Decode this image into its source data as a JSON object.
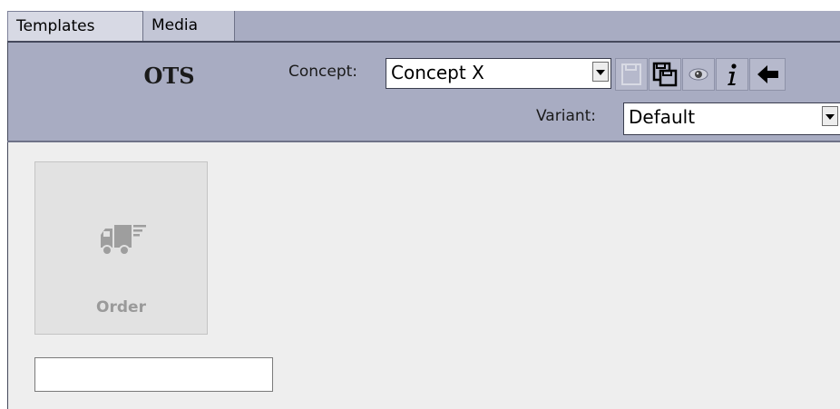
{
  "tabs": [
    {
      "label": "Templates",
      "active": true
    },
    {
      "label": "Media",
      "active": false
    }
  ],
  "header": {
    "title": "OTS",
    "concept_label": "Concept:",
    "concept_value": "Concept X",
    "variant_label": "Variant:",
    "variant_value": "Default"
  },
  "toolbar": {
    "icons": [
      "save-icon",
      "save-all-icon",
      "preview-eye-icon",
      "info-icon",
      "back-arrow-icon"
    ]
  },
  "templates": [
    {
      "label": "Order",
      "icon": "delivery-truck-icon"
    }
  ],
  "name_field": {
    "value": ""
  },
  "colors": {
    "header_bg": "#a8acc2",
    "content_bg": "#eeeeee",
    "icon_disabled": "#9e9e9e"
  }
}
